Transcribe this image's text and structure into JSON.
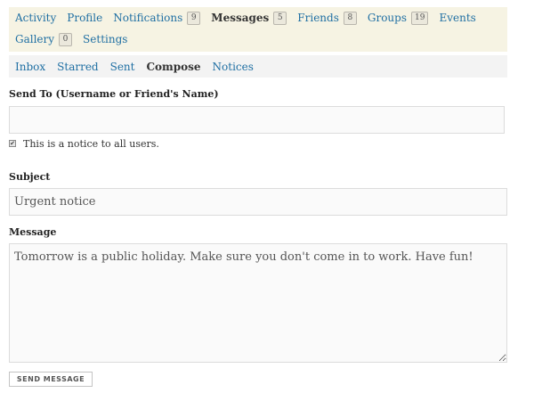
{
  "nav_main": {
    "items": [
      {
        "label": "Activity"
      },
      {
        "label": "Profile"
      },
      {
        "label": "Notifications",
        "count": "9"
      },
      {
        "label": "Messages",
        "count": "5"
      },
      {
        "label": "Friends",
        "count": "8"
      },
      {
        "label": "Groups",
        "count": "19"
      },
      {
        "label": "Events"
      },
      {
        "label": "Gallery",
        "count": "0"
      },
      {
        "label": "Settings"
      }
    ],
    "current": "Messages"
  },
  "nav_sub": {
    "items": [
      {
        "label": "Inbox"
      },
      {
        "label": "Starred"
      },
      {
        "label": "Sent"
      },
      {
        "label": "Compose"
      },
      {
        "label": "Notices"
      }
    ],
    "current": "Compose"
  },
  "form": {
    "send_to_label": "Send To (Username or Friend's Name)",
    "send_to_value": "",
    "notice_checkbox_checked": true,
    "notice_checkbox_label": "This is a notice to all users.",
    "subject_label": "Subject",
    "subject_value": "Urgent notice",
    "message_label": "Message",
    "message_value": "Tomorrow is a public holiday. Make sure you don't come in to work. Have fun!",
    "send_button_label": "SEND MESSAGE"
  },
  "colors": {
    "link": "#1f6fa3",
    "nav_main_bg": "#f6f3e3",
    "nav_sub_bg": "#f3f3f3"
  }
}
